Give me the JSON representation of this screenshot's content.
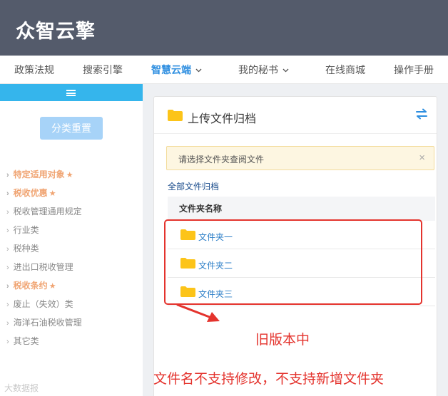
{
  "app": {
    "logo": "众智云擎"
  },
  "nav": [
    {
      "label": "政策法规",
      "has_dropdown": false,
      "active": false
    },
    {
      "label": "搜索引擎",
      "has_dropdown": false,
      "active": false
    },
    {
      "label": "智慧云端",
      "has_dropdown": true,
      "active": true
    },
    {
      "label": "我的秘书",
      "has_dropdown": true,
      "active": false
    },
    {
      "label": "在线商城",
      "has_dropdown": false,
      "active": false
    },
    {
      "label": "操作手册",
      "has_dropdown": false,
      "active": false
    }
  ],
  "sidebar": {
    "toggle_icon": "hamburger-icon",
    "reset_button": "分类重置",
    "categories": [
      {
        "label": "特定适用对象",
        "highlighted": true,
        "starred": true
      },
      {
        "label": "税收优惠",
        "highlighted": true,
        "starred": true
      },
      {
        "label": "税收管理通用规定",
        "highlighted": false,
        "starred": false
      },
      {
        "label": "行业类",
        "highlighted": false,
        "starred": false
      },
      {
        "label": "税种类",
        "highlighted": false,
        "starred": false
      },
      {
        "label": "进出口税收管理",
        "highlighted": false,
        "starred": false
      },
      {
        "label": "税收条约",
        "highlighted": true,
        "starred": true
      },
      {
        "label": "废止（失效）类",
        "highlighted": false,
        "starred": false
      },
      {
        "label": "海洋石油税收管理",
        "highlighted": false,
        "starred": false
      },
      {
        "label": "其它类",
        "highlighted": false,
        "starred": false
      }
    ]
  },
  "panel": {
    "title": "上传文件归档",
    "notice": "请选择文件夹查阅文件",
    "close_glyph": "×",
    "all_link": "全部文件归档",
    "table_header": "文件夹名称",
    "folders": [
      "文件夹一",
      "文件夹二",
      "文件夹三"
    ]
  },
  "annotations": {
    "old_version": "旧版本中",
    "limitation": "文件名不支持修改，不支持新增文件夹"
  },
  "watermark": "大数据报",
  "colors": {
    "topbar": "#545b6b",
    "accent": "#2d8ee0",
    "sidebar_toggle": "#35b5ec",
    "highlight": "#f0a472",
    "folder": "#fcc419",
    "annotation": "#e4332d"
  }
}
